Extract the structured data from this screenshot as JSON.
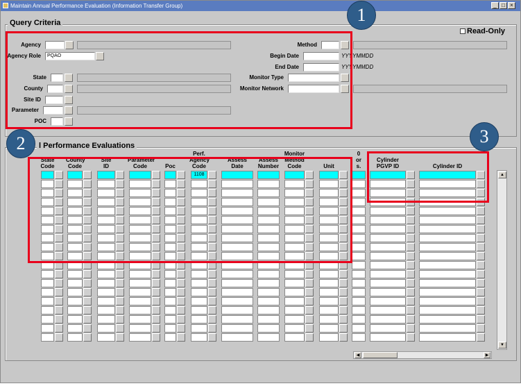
{
  "window": {
    "title": "Maintain Annual Performance Evaluation (Information Transfer Group)"
  },
  "query": {
    "title": "Query Criteria",
    "read_only_label": "Read-Only",
    "labels": {
      "agency": "Agency",
      "agency_role": "Agency Role",
      "state": "State",
      "county": "County",
      "site_id": "Site ID",
      "parameter": "Parameter",
      "poc": "POC",
      "method": "Method",
      "begin_date": "Begin Date",
      "end_date": "End Date",
      "monitor_type": "Monitor Type",
      "monitor_network": "Monitor Network"
    },
    "values": {
      "agency_role": "PQAO"
    },
    "date_hint": "YYYYMMDD"
  },
  "grid": {
    "title": "l Performance Evaluations",
    "headers": [
      [
        "State",
        "Code"
      ],
      [
        "County",
        "Code"
      ],
      [
        "Site",
        "ID"
      ],
      [
        "Parameter",
        "Code"
      ],
      [
        "",
        "Poc"
      ],
      [
        "Perf.",
        "Agency",
        "Code"
      ],
      [
        "Assess",
        "Date"
      ],
      [
        "Assess",
        "Number"
      ],
      [
        "Monitor",
        "Method",
        "Code"
      ],
      [
        "",
        "Unit"
      ],
      [
        "0",
        "or",
        "s."
      ],
      [
        "Cylinder",
        "PGVP ID"
      ],
      [
        "",
        "Cylinder ID"
      ]
    ],
    "first_row": {
      "perf_agency_code": "1108"
    }
  },
  "markers": [
    "1",
    "2",
    "3"
  ],
  "colors": {
    "highlight_row": "#00ffff",
    "annotation_box": "#e8001c",
    "marker_fill": "#2f5d8a",
    "title_bar": "#5a7cc0"
  }
}
